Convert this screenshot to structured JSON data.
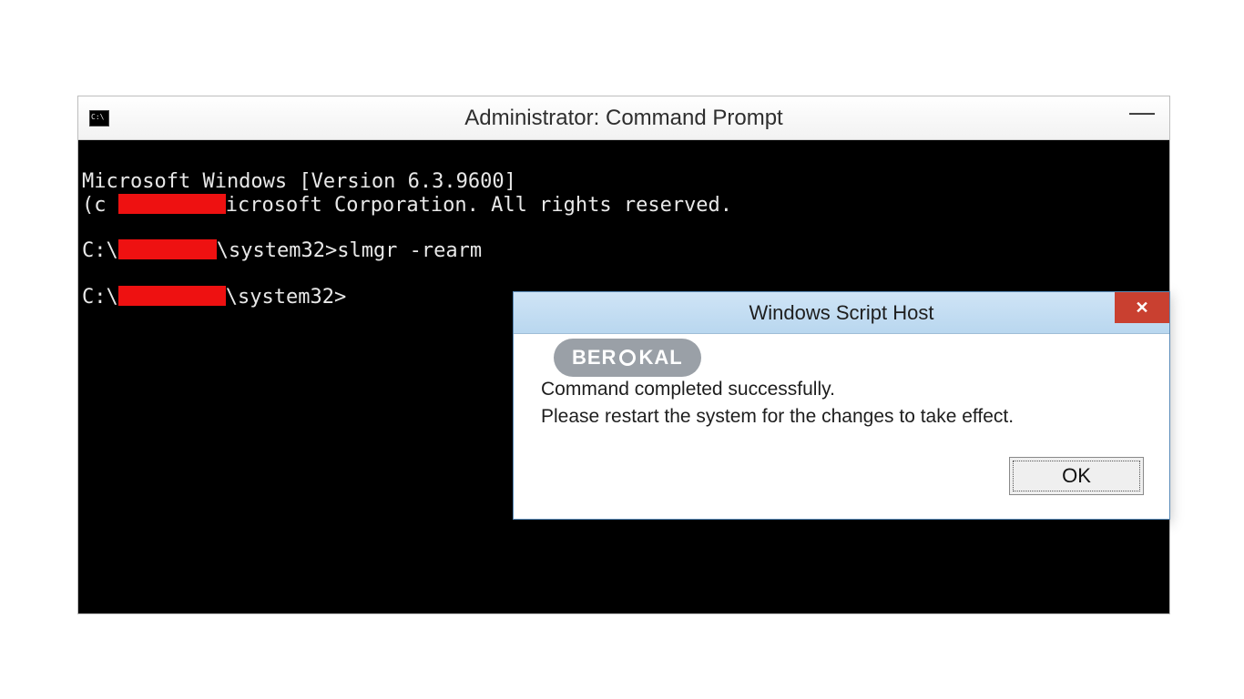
{
  "cmd": {
    "title": "Administrator: Command Prompt",
    "minimize": "—",
    "line1_pre": "Microsoft Windows [Version 6.3.9600]",
    "line2_pre": "(c",
    "line2_post": "icrosoft Corporation. All rights reserved.",
    "line3_pre": "C:\\",
    "line3_mid": "\\system32>",
    "line3_cmd": "slmgr -rearm",
    "line4_pre": "C:\\",
    "line4_post": "\\system32>"
  },
  "dialog": {
    "title": "Windows Script Host",
    "close_symbol": "✕",
    "msg1": "Command completed successfully.",
    "msg2": "Please restart the system for the changes to take effect.",
    "ok_label": "OK"
  },
  "watermark": {
    "prefix": "BER",
    "suffix": "KAL"
  }
}
